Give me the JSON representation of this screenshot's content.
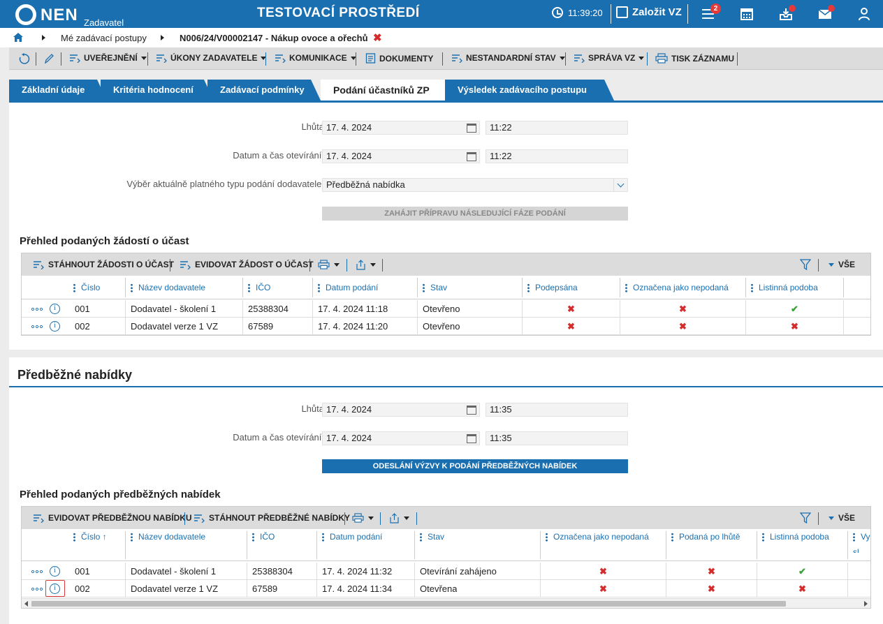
{
  "header": {
    "logo_text": "NEN",
    "logo_sub": "Zadavatel",
    "env_title": "TESTOVACÍ PROSTŘEDÍ",
    "time": "11:39:20",
    "new_vz_label": "Založit VZ",
    "menu_badge": "2",
    "icons": [
      "clock-icon",
      "edit-icon",
      "menu-icon",
      "calendar-icon",
      "inbox-icon",
      "mail-icon",
      "user-icon"
    ]
  },
  "breadcrumb": {
    "items": [
      "Mé zadávací postupy",
      "N006/24/V00002147 - Nákup ovoce a ořechů"
    ],
    "close": "✖"
  },
  "actions": [
    "UVEŘEJNĚNÍ",
    "ÚKONY ZADAVATELE",
    "KOMUNIKACE",
    "DOKUMENTY",
    "NESTANDARDNÍ STAV",
    "SPRÁVA VZ",
    "TISK ZÁZNAMU"
  ],
  "tabs": [
    "Základní údaje",
    "Kritéria hodnocení",
    "Zadávací podmínky",
    "Podání účastníků ZP",
    "Výsledek zadávacího postupu"
  ],
  "section1": {
    "lhuta_label": "Lhůta",
    "lhuta_date": "17. 4. 2024",
    "lhuta_time": "11:22",
    "otevirani_label": "Datum a čas otevírání:",
    "otevirani_date": "17. 4. 2024",
    "otevirani_time": "11:22",
    "typ_label": "Výběr aktuálně platného typu podání dodavatele:",
    "typ_value": "Předběžná nabídka",
    "btn_disabled": "ZAHÁJIT PŘÍPRAVU NÁSLEDUJÍCÍ FÁZE PODÁNÍ",
    "grid_title": "Přehled podaných žádostí o účast",
    "toolbar": {
      "btn1": "STÁHNOUT ŽÁDOSTI O ÚČAST",
      "btn2": "EVIDOVAT ŽÁDOST O ÚČAST",
      "all": "VŠE"
    },
    "columns": [
      "Číslo",
      "Název dodavatele",
      "IČO",
      "Datum podání",
      "Stav",
      "Podepsána",
      "Označena jako nepodaná",
      "Listinná podoba"
    ],
    "rows": [
      {
        "cislo": "001",
        "nazev": "Dodavatel - školení 1",
        "ico": "25388304",
        "datum": "17. 4. 2024 11:18",
        "stav": "Otevřeno",
        "podepsana": "✖",
        "nepodana": "✖",
        "listinna": "✔"
      },
      {
        "cislo": "002",
        "nazev": "Dodavatel verze 1 VZ",
        "ico": "67589",
        "datum": "17. 4. 2024 11:20",
        "stav": "Otevřeno",
        "podepsana": "✖",
        "nepodana": "✖",
        "listinna": "✖"
      }
    ]
  },
  "section2": {
    "title": "Předběžné nabídky",
    "lhuta_label": "Lhůta",
    "lhuta_date": "17. 4. 2024",
    "lhuta_time": "11:35",
    "otevirani_label": "Datum a čas otevírání:",
    "otevirani_date": "17. 4. 2024",
    "otevirani_time": "11:35",
    "btn_primary": "ODESLÁNÍ VÝZVY K PODÁNÍ PŘEDBĚŽNÝCH NABÍDEK",
    "grid_title": "Přehled podaných předběžných nabídek",
    "toolbar": {
      "btn1": "EVIDOVAT PŘEDBĚŽNOU NABÍDKU",
      "btn2": "STÁHNOUT PŘEDBĚŽNÉ NABÍDKY",
      "all": "VŠE"
    },
    "columns": [
      "Číslo ↑",
      "Název dodavatele",
      "IČO",
      "Datum podání",
      "Stav",
      "Označena jako nepodaná",
      "Podaná po lhůtě",
      "Listinná podoba",
      "Vy sl"
    ],
    "rows": [
      {
        "cislo": "001",
        "nazev": "Dodavatel - školení 1",
        "ico": "25388304",
        "datum": "17. 4. 2024 11:32",
        "stav": "Otevírání zahájeno",
        "nepodana": "✖",
        "po_lhute": "✖",
        "listinna": "✔"
      },
      {
        "cislo": "002",
        "nazev": "Dodavatel verze 1 VZ",
        "ico": "67589",
        "datum": "17. 4. 2024 11:34",
        "stav": "Otevřena",
        "nepodana": "✖",
        "po_lhute": "✖",
        "listinna": "✖"
      }
    ]
  },
  "colors": {
    "primary": "#1a6fb0",
    "error": "#d62b2b",
    "success": "#3aa33a"
  }
}
